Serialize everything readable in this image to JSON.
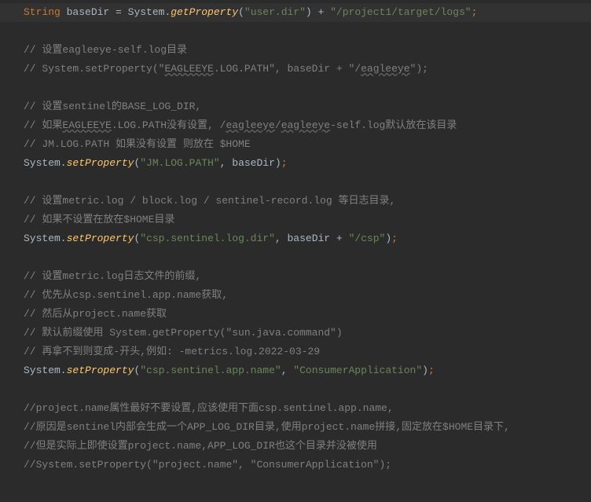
{
  "code": {
    "line1": {
      "type": "String",
      "var": " baseDir ",
      "eq": "= ",
      "obj": "System.",
      "method": "getProperty",
      "open": "(",
      "str1": "\"user.dir\"",
      "close": ")",
      "plus": " + ",
      "str2": "\"/project1/target/logs\"",
      "semi": ";"
    },
    "comment1": "// 设置eagleeye-self.log目录",
    "comment2_a": "// System.setProperty(\"",
    "comment2_b": "EAGLEEYE",
    "comment2_c": ".LOG.PATH\", baseDir + \"/",
    "comment2_d": "eagleeye",
    "comment2_e": "\");",
    "comment3": "// 设置sentinel的BASE_LOG_DIR,",
    "comment4_a": "// 如果",
    "comment4_b": "EAGLEEYE",
    "comment4_c": ".LOG.PATH没有设置, /",
    "comment4_d": "eagleeye",
    "comment4_e": "/",
    "comment4_f": "eagleeye",
    "comment4_g": "-self.log默认放在该目录",
    "comment5": "// JM.LOG.PATH 如果没有设置 则放在 $HOME",
    "line_sp1": {
      "obj": "System.",
      "method": "setProperty",
      "open": "(",
      "str": "\"JM.LOG.PATH\"",
      "comma": ", ",
      "var": "baseDir",
      "close": ")",
      "semi": ";"
    },
    "comment6": "// 设置metric.log / block.log / sentinel-record.log 等日志目录,",
    "comment7": "// 如果不设置在放在$HOME目录",
    "line_sp2": {
      "obj": "System.",
      "method": "setProperty",
      "open": "(",
      "str1": "\"csp.sentinel.log.dir\"",
      "comma": ", ",
      "var": "baseDir",
      "plus": " + ",
      "str2": "\"/csp\"",
      "close": ")",
      "semi": ";"
    },
    "comment8": "// 设置metric.log日志文件的前缀,",
    "comment9": "// 优先从csp.sentinel.app.name获取,",
    "comment10": "// 然后从project.name获取",
    "comment11": "// 默认前缀使用 System.getProperty(\"sun.java.command\")",
    "comment12": "// 再拿不到则变成-开头,例如: -metrics.log.2022-03-29",
    "line_sp3": {
      "obj": "System.",
      "method": "setProperty",
      "open": "(",
      "str1": "\"csp.sentinel.app.name\"",
      "comma": ", ",
      "str2": "\"ConsumerApplication\"",
      "close": ")",
      "semi": ";"
    },
    "comment13": "//project.name属性最好不要设置,应该使用下面csp.sentinel.app.name,",
    "comment14": "//原因是sentinel内部会生成一个APP_LOG_DIR目录,使用project.name拼接,固定放在$HOME目录下,",
    "comment15": "//但是实际上即使设置project.name,APP_LOG_DIR也这个目录并没被使用",
    "comment16": "//System.setProperty(\"project.name\", \"ConsumerApplication\");"
  }
}
